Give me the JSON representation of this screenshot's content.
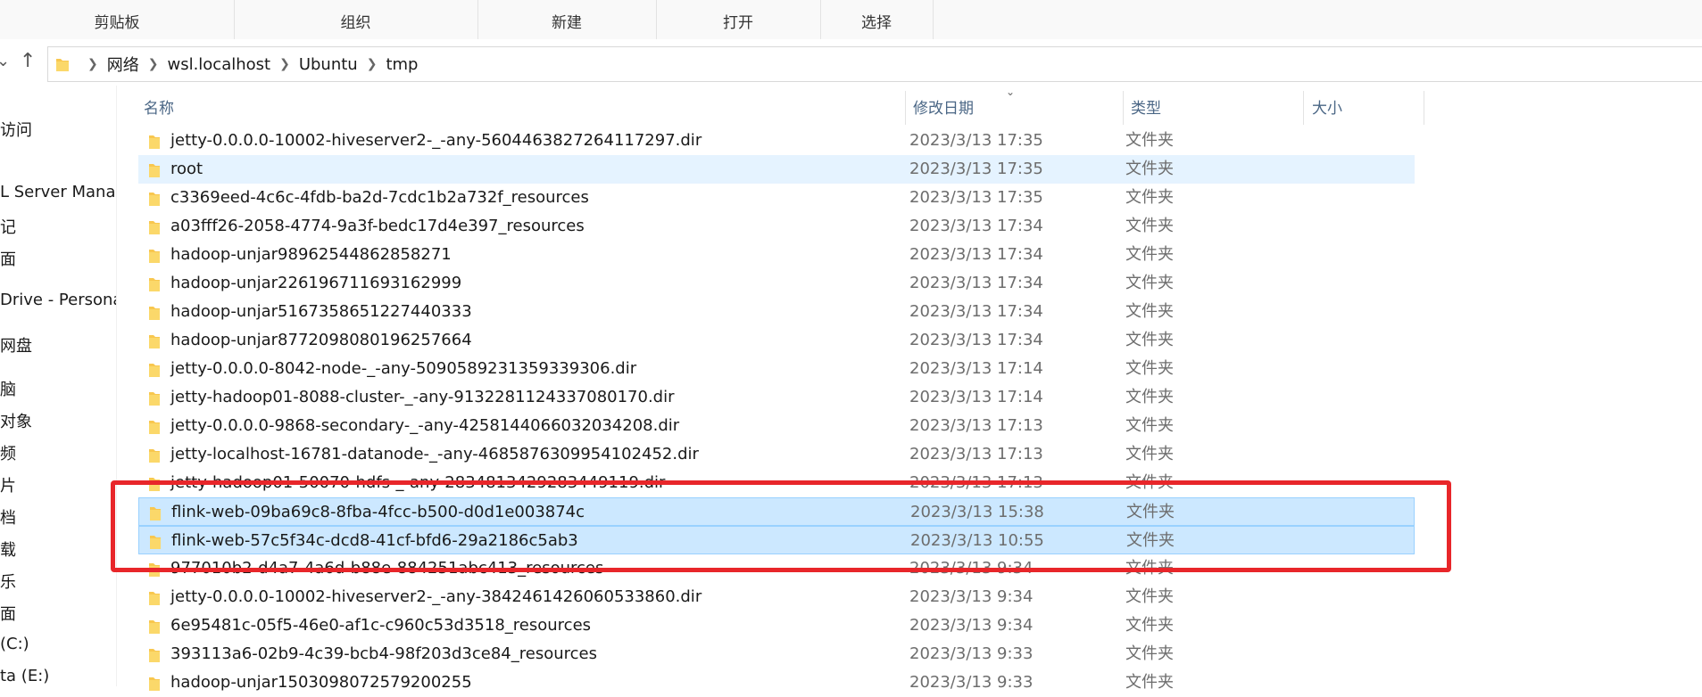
{
  "ribbon": {
    "groups": [
      "剪贴板",
      "组织",
      "新建",
      "打开",
      "选择"
    ]
  },
  "address": {
    "crumbs": [
      "网络",
      "wsl.localhost",
      "Ubuntu",
      "tmp"
    ]
  },
  "navpane": {
    "items": [
      "访问",
      "L Server Manag",
      "记",
      "面",
      "Drive - Personal",
      "网盘",
      "脑",
      "对象",
      "频",
      "片",
      "档",
      "载",
      "乐",
      "面",
      "(C:)",
      "ta (E:)"
    ]
  },
  "columns": {
    "name": "名称",
    "date": "修改日期",
    "type": "类型",
    "size": "大小"
  },
  "files": [
    {
      "name": "jetty-0.0.0.0-10002-hiveserver2-_-any-5604463827264117297.dir",
      "date": "2023/3/13 17:35",
      "type": "文件夹"
    },
    {
      "name": "root",
      "date": "2023/3/13 17:35",
      "type": "文件夹"
    },
    {
      "name": "c3369eed-4c6c-4fdb-ba2d-7cdc1b2a732f_resources",
      "date": "2023/3/13 17:35",
      "type": "文件夹"
    },
    {
      "name": "a03fff26-2058-4774-9a3f-bedc17d4e397_resources",
      "date": "2023/3/13 17:34",
      "type": "文件夹"
    },
    {
      "name": "hadoop-unjar98962544862858271",
      "date": "2023/3/13 17:34",
      "type": "文件夹"
    },
    {
      "name": "hadoop-unjar226196711693162999",
      "date": "2023/3/13 17:34",
      "type": "文件夹"
    },
    {
      "name": "hadoop-unjar5167358651227440333",
      "date": "2023/3/13 17:34",
      "type": "文件夹"
    },
    {
      "name": "hadoop-unjar8772098080196257664",
      "date": "2023/3/13 17:34",
      "type": "文件夹"
    },
    {
      "name": "jetty-0.0.0.0-8042-node-_-any-5090589231359339306.dir",
      "date": "2023/3/13 17:14",
      "type": "文件夹"
    },
    {
      "name": "jetty-hadoop01-8088-cluster-_-any-9132281124337080170.dir",
      "date": "2023/3/13 17:14",
      "type": "文件夹"
    },
    {
      "name": "jetty-0.0.0.0-9868-secondary-_-any-4258144066032034208.dir",
      "date": "2023/3/13 17:13",
      "type": "文件夹"
    },
    {
      "name": "jetty-localhost-16781-datanode-_-any-4685876309954102452.dir",
      "date": "2023/3/13 17:13",
      "type": "文件夹"
    },
    {
      "name": "jetty-hadoop01-50070-hdfs-_-any-2834813429283449119.dir",
      "date": "2023/3/13 17:13",
      "type": "文件夹"
    },
    {
      "name": "flink-web-09ba69c8-8fba-4fcc-b500-d0d1e003874c",
      "date": "2023/3/13 15:38",
      "type": "文件夹"
    },
    {
      "name": "flink-web-57c5f34c-dcd8-41cf-bfd6-29a2186c5ab3",
      "date": "2023/3/13 10:55",
      "type": "文件夹"
    },
    {
      "name": "977010b2-d4a7-4a6d-b88e-884251abc413_resources",
      "date": "2023/3/13 9:34",
      "type": "文件夹"
    },
    {
      "name": "jetty-0.0.0.0-10002-hiveserver2-_-any-3842461426060533860.dir",
      "date": "2023/3/13 9:34",
      "type": "文件夹"
    },
    {
      "name": "6e95481c-05f5-46e0-af1c-c960c53d3518_resources",
      "date": "2023/3/13 9:34",
      "type": "文件夹"
    },
    {
      "name": "393113a6-02b9-4c39-bcb4-98f203d3ce84_resources",
      "date": "2023/3/13 9:33",
      "type": "文件夹"
    },
    {
      "name": "hadoop-unjar1503098072579200255",
      "date": "2023/3/13 9:33",
      "type": "文件夹"
    }
  ],
  "row_states": {
    "hover": [
      1
    ],
    "selected": [
      13,
      14
    ]
  },
  "colors": {
    "selection": "#cce8ff",
    "hover": "#e5f3ff",
    "annotation": "#e8262a",
    "folder": "#f8c74f"
  }
}
